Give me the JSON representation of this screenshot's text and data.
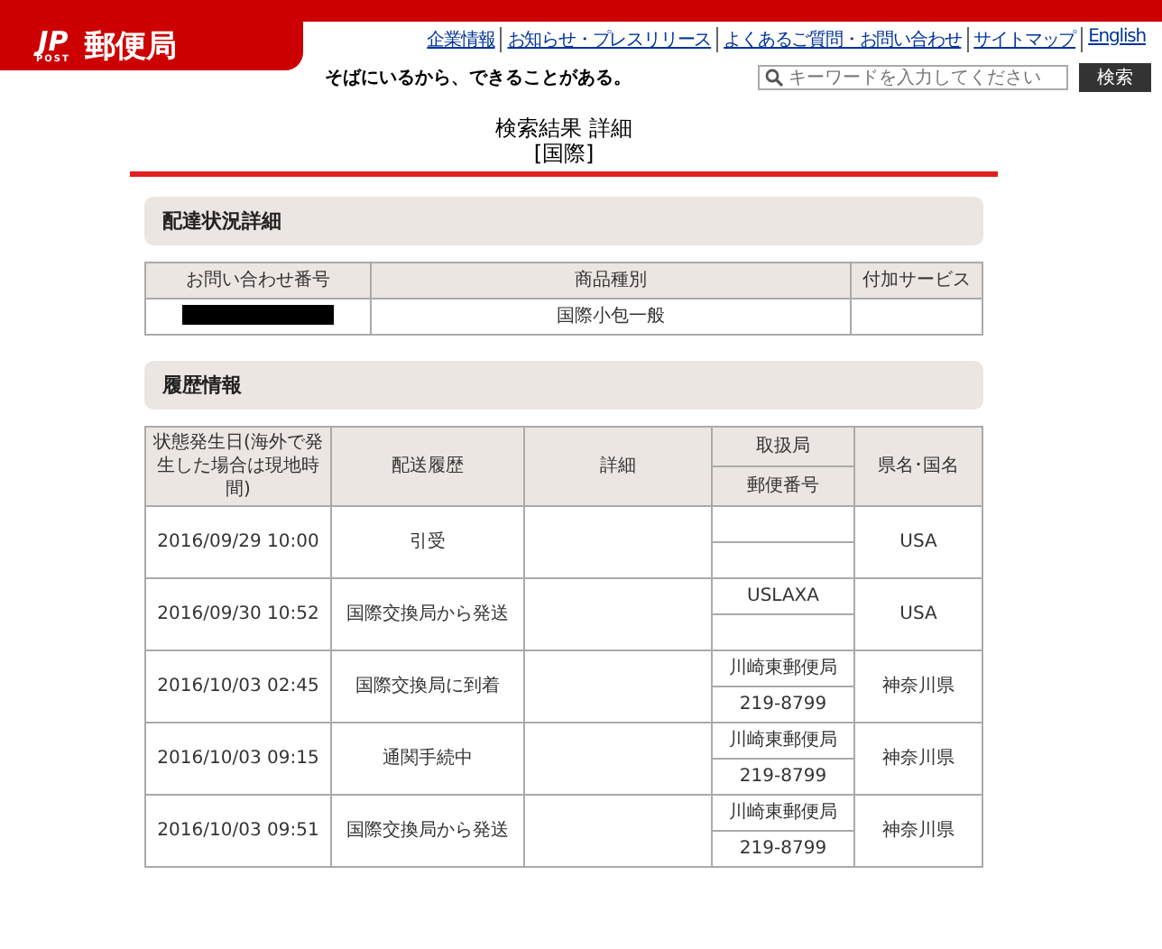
{
  "header": {
    "logo_mark": "JP",
    "logo_sub": "POST",
    "site_name": "郵便局",
    "tagline": "そばにいるから、できることがある。",
    "links": [
      "企業情報",
      "お知らせ・プレスリリース",
      "よくあるご質問・お問い合わせ",
      "サイトマップ",
      "English"
    ],
    "search": {
      "placeholder": "キーワードを入力してください",
      "button": "検索"
    }
  },
  "title": {
    "line1": "検索結果 詳細",
    "line2": "[国際]"
  },
  "summary": {
    "heading": "配達状況詳細",
    "columns": [
      "お問い合わせ番号",
      "商品種別",
      "付加サービス"
    ],
    "row": {
      "tracking_redacted": true,
      "product": "国際小包一般"
    }
  },
  "history": {
    "heading": "履歴情報",
    "columns": {
      "date": "状態発生日(海外で発生した場合は現地時間)",
      "event": "配送履歴",
      "detail": "詳細",
      "office": "取扱局",
      "postal": "郵便番号",
      "region": "県名･国名"
    },
    "rows": [
      {
        "date": "2016/09/29 10:00",
        "event": "引受",
        "region": "USA"
      },
      {
        "date": "2016/09/30 10:52",
        "event": "国際交換局から発送",
        "office": "USLAXA",
        "region": "USA"
      },
      {
        "date": "2016/10/03 02:45",
        "event": "国際交換局に到着",
        "office": "川崎東郵便局",
        "postal": "219-8799",
        "region": "神奈川県"
      },
      {
        "date": "2016/10/03 09:15",
        "event": "通関手続中",
        "office": "川崎東郵便局",
        "postal": "219-8799",
        "region": "神奈川県"
      },
      {
        "date": "2016/10/03 09:51",
        "event": "国際交換局から発送",
        "office": "川崎東郵便局",
        "postal": "219-8799",
        "region": "神奈川県"
      }
    ]
  }
}
